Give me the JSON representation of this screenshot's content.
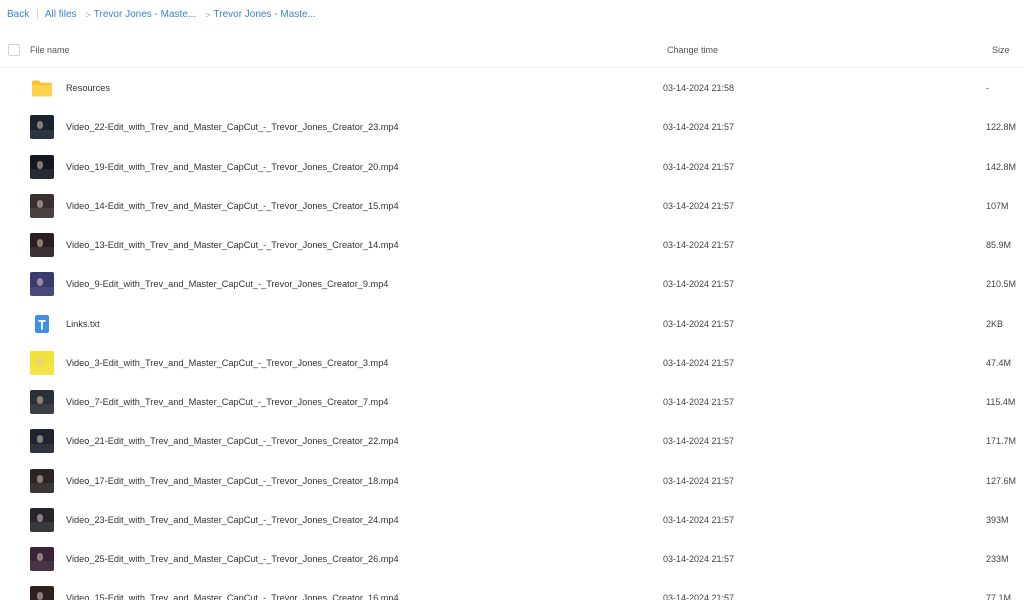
{
  "breadcrumb": {
    "back": "Back",
    "all_files": "All files",
    "crumb1": "Trevor Jones - Maste...",
    "crumb2": "Trevor Jones - Maste..."
  },
  "table": {
    "headers": {
      "name": "File name",
      "time": "Change time",
      "size": "Size"
    },
    "rows": [
      {
        "name": "Resources",
        "time": "03-14-2024 21:58",
        "size": "-",
        "icon": "folder-icon",
        "thumb_color": "#f6c22f"
      },
      {
        "name": "Video_22-Edit_with_Trev_and_Master_CapCut_-_Trevor_Jones_Creator_23.mp4",
        "time": "03-14-2024 21:57",
        "size": "122.8M",
        "icon": "video-thumbnail",
        "thumb_color": "#1c2230"
      },
      {
        "name": "Video_19-Edit_with_Trev_and_Master_CapCut_-_Trevor_Jones_Creator_20.mp4",
        "time": "03-14-2024 21:57",
        "size": "142.8M",
        "icon": "video-thumbnail",
        "thumb_color": "#141820"
      },
      {
        "name": "Video_14-Edit_with_Trev_and_Master_CapCut_-_Trevor_Jones_Creator_15.mp4",
        "time": "03-14-2024 21:57",
        "size": "107M",
        "icon": "video-thumbnail",
        "thumb_color": "#3a3030"
      },
      {
        "name": "Video_13-Edit_with_Trev_and_Master_CapCut_-_Trevor_Jones_Creator_14.mp4",
        "time": "03-14-2024 21:57",
        "size": "85.9M",
        "icon": "video-thumbnail",
        "thumb_color": "#2a1e22"
      },
      {
        "name": "Video_9-Edit_with_Trev_and_Master_CapCut_-_Trevor_Jones_Creator_9.mp4",
        "time": "03-14-2024 21:57",
        "size": "210.5M",
        "icon": "video-thumbnail",
        "thumb_color": "#3b3a6e"
      },
      {
        "name": "Links.txt",
        "time": "03-14-2024 21:57",
        "size": "2KB",
        "icon": "text-file-icon",
        "thumb_color": "#3f8fe8"
      },
      {
        "name": "Video_3-Edit_with_Trev_and_Master_CapCut_-_Trevor_Jones_Creator_3.mp4",
        "time": "03-14-2024 21:57",
        "size": "47.4M",
        "icon": "video-thumbnail",
        "thumb_color": "#f2e23a"
      },
      {
        "name": "Video_7-Edit_with_Trev_and_Master_CapCut_-_Trevor_Jones_Creator_7.mp4",
        "time": "03-14-2024 21:57",
        "size": "115.4M",
        "icon": "video-thumbnail",
        "thumb_color": "#2b3038"
      },
      {
        "name": "Video_21-Edit_with_Trev_and_Master_CapCut_-_Trevor_Jones_Creator_22.mp4",
        "time": "03-14-2024 21:57",
        "size": "171.7M",
        "icon": "video-thumbnail",
        "thumb_color": "#1f2430"
      },
      {
        "name": "Video_17-Edit_with_Trev_and_Master_CapCut_-_Trevor_Jones_Creator_18.mp4",
        "time": "03-14-2024 21:57",
        "size": "127.6M",
        "icon": "video-thumbnail",
        "thumb_color": "#2c2424"
      },
      {
        "name": "Video_23-Edit_with_Trev_and_Master_CapCut_-_Trevor_Jones_Creator_24.mp4",
        "time": "03-14-2024 21:57",
        "size": "393M",
        "icon": "video-thumbnail",
        "thumb_color": "#26262c"
      },
      {
        "name": "Video_25-Edit_with_Trev_and_Master_CapCut_-_Trevor_Jones_Creator_26.mp4",
        "time": "03-14-2024 21:57",
        "size": "233M",
        "icon": "video-thumbnail",
        "thumb_color": "#3a2238"
      },
      {
        "name": "Video_15-Edit_with_Trev_and_Master_CapCut_-_Trevor_Jones_Creator_16.mp4",
        "time": "03-14-2024 21:57",
        "size": "77.1M",
        "icon": "video-thumbnail",
        "thumb_color": "#302020"
      }
    ]
  }
}
